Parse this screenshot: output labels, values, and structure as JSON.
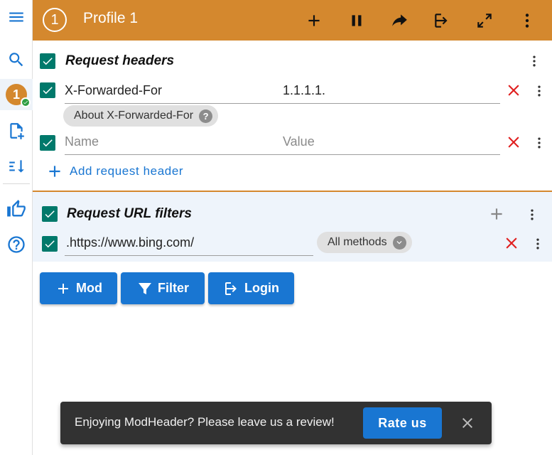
{
  "sidebar": {
    "menu_icon": "menu-icon",
    "search_icon": "search-icon",
    "profile_badge_number": "1",
    "add_profile_icon": "add-document-icon",
    "sort_icon": "sort-icon",
    "thumbs_up_icon": "thumbs-up-icon",
    "help_icon": "help-icon"
  },
  "header": {
    "profile_number": "1",
    "title": "Profile 1",
    "background_color": "#d4882e",
    "actions": [
      "plus-icon",
      "pause-icon",
      "share-icon",
      "login-icon",
      "expand-icon",
      "more-vert-icon"
    ]
  },
  "request_headers": {
    "title": "Request headers",
    "rows": [
      {
        "name": "X-Forwarded-For",
        "value": "1.1.1.1.",
        "enabled": true
      },
      {
        "name_placeholder": "Name",
        "value_placeholder": "Value",
        "enabled": true
      }
    ],
    "about_chip": "About X-Forwarded-For",
    "about_chip_icon": "?",
    "add_label": "Add request header"
  },
  "url_filters": {
    "title": "Request URL filters",
    "filter_value": ".https://www.bing.com/",
    "methods_chip": "All methods",
    "enabled": true
  },
  "actions": {
    "mod_label": "Mod",
    "filter_label": "Filter",
    "login_label": "Login"
  },
  "snackbar": {
    "message": "Enjoying ModHeader? Please leave us a review!",
    "rate_label": "Rate us"
  },
  "colors": {
    "accent": "#1976d2",
    "checkbox": "#00796b",
    "delete": "#e02020",
    "profile": "#d4882e"
  }
}
